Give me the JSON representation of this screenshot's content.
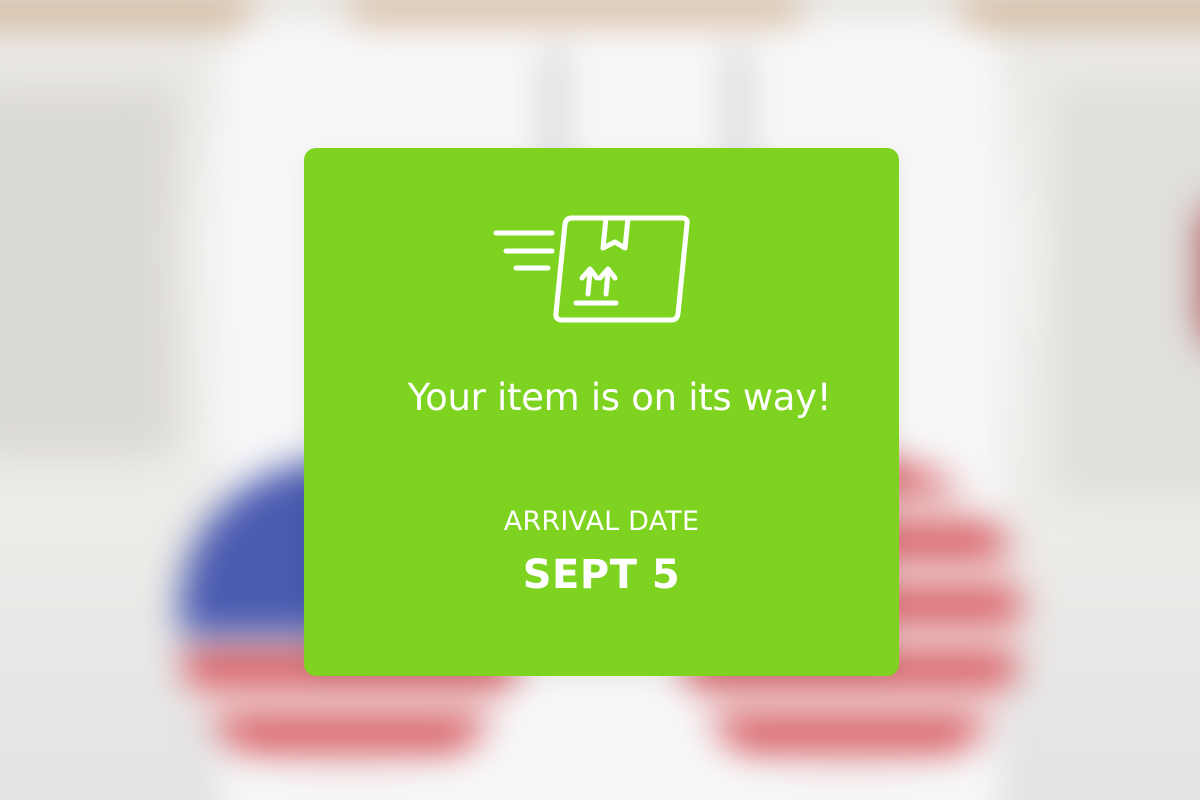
{
  "background": {
    "description_icon": "blurred-photo-background"
  },
  "notification": {
    "icon": "package-shipping-icon",
    "message": "Your item is on its way!",
    "arrival_label": "ARRIVAL DATE",
    "arrival_date": "SEPT 5",
    "colors": {
      "card": "#7ed321",
      "text": "#ffffff"
    }
  }
}
